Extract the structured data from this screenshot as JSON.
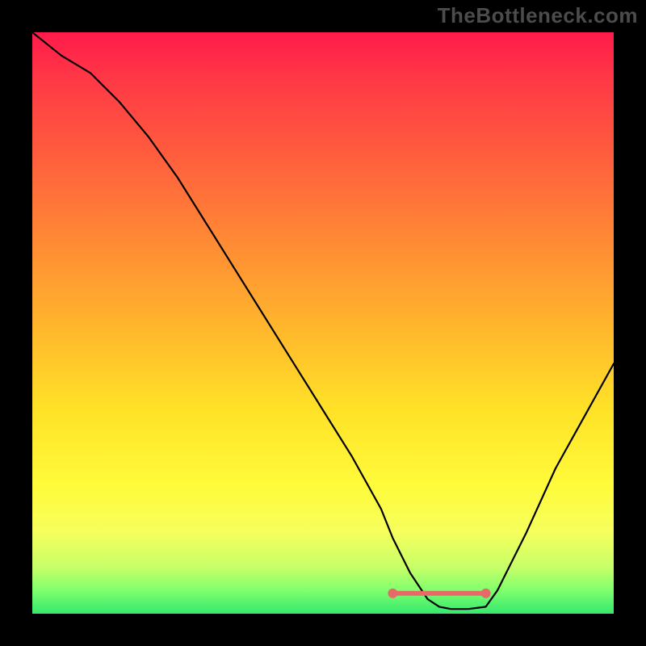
{
  "watermark": "TheBottleneck.com",
  "chart_data": {
    "type": "line",
    "title": "",
    "xlabel": "",
    "ylabel": "",
    "xlim": [
      0,
      100
    ],
    "ylim": [
      0,
      100
    ],
    "grid": false,
    "x": [
      0,
      5,
      10,
      15,
      20,
      25,
      30,
      35,
      40,
      45,
      50,
      55,
      60,
      62,
      65,
      68,
      70,
      72,
      75,
      78,
      80,
      85,
      90,
      95,
      100
    ],
    "values": [
      100,
      96,
      93,
      88,
      82,
      75,
      67,
      59,
      51,
      43,
      35,
      27,
      18,
      13,
      7,
      2.5,
      1.2,
      0.8,
      0.8,
      1.2,
      4,
      14,
      25,
      34,
      43
    ],
    "optimal_zone": {
      "x_start": 62,
      "x_end": 78,
      "y": 3.5
    },
    "background_gradient_meaning": "value color scale: red=high bottleneck, green=optimal"
  }
}
